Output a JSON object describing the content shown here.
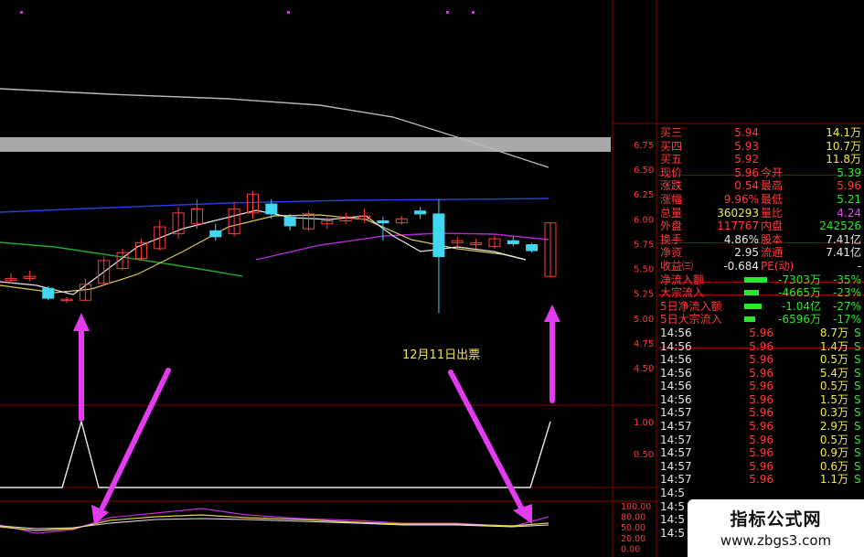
{
  "chart_data": {
    "type": "candlestick",
    "price_axis": {
      "ticks": [
        "6.75",
        "6.50",
        "6.25",
        "6.00",
        "5.75",
        "5.50",
        "5.25",
        "5.00",
        "4.75",
        "4.50"
      ],
      "range": [
        4.5,
        6.75
      ]
    },
    "candles": [
      {
        "o": 5.38,
        "c": 5.4,
        "h": 5.45,
        "l": 5.35
      },
      {
        "o": 5.4,
        "c": 5.42,
        "h": 5.48,
        "l": 5.37
      },
      {
        "o": 5.3,
        "c": 5.2,
        "h": 5.32,
        "l": 5.18
      },
      {
        "o": 5.18,
        "c": 5.19,
        "h": 5.21,
        "l": 5.15
      },
      {
        "o": 5.18,
        "c": 5.34,
        "h": 5.4,
        "l": 5.18
      },
      {
        "o": 5.35,
        "c": 5.58,
        "h": 5.62,
        "l": 5.33
      },
      {
        "o": 5.5,
        "c": 5.66,
        "h": 5.7,
        "l": 5.48
      },
      {
        "o": 5.6,
        "c": 5.76,
        "h": 5.8,
        "l": 5.58
      },
      {
        "o": 5.7,
        "c": 5.92,
        "h": 5.98,
        "l": 5.68
      },
      {
        "o": 5.85,
        "c": 6.06,
        "h": 6.12,
        "l": 5.8
      },
      {
        "o": 5.95,
        "c": 6.1,
        "h": 6.2,
        "l": 5.9
      },
      {
        "o": 5.88,
        "c": 5.82,
        "h": 5.95,
        "l": 5.78
      },
      {
        "o": 5.85,
        "c": 6.1,
        "h": 6.17,
        "l": 5.82
      },
      {
        "o": 6.06,
        "c": 6.25,
        "h": 6.28,
        "l": 6.0
      },
      {
        "o": 6.15,
        "c": 6.05,
        "h": 6.2,
        "l": 6.0
      },
      {
        "o": 6.02,
        "c": 5.93,
        "h": 6.05,
        "l": 5.88
      },
      {
        "o": 5.9,
        "c": 6.05,
        "h": 6.08,
        "l": 5.88
      },
      {
        "o": 5.95,
        "c": 5.98,
        "h": 6.02,
        "l": 5.9
      },
      {
        "o": 5.98,
        "c": 6.02,
        "h": 6.06,
        "l": 5.95
      },
      {
        "o": 6.0,
        "c": 6.03,
        "h": 6.1,
        "l": 5.96
      },
      {
        "o": 5.98,
        "c": 5.96,
        "h": 6.02,
        "l": 5.78
      },
      {
        "o": 5.96,
        "c": 6.0,
        "h": 6.03,
        "l": 5.94
      },
      {
        "o": 6.08,
        "c": 6.05,
        "h": 6.12,
        "l": 6.0
      },
      {
        "o": 6.05,
        "c": 5.62,
        "h": 6.2,
        "l": 5.05
      },
      {
        "o": 5.76,
        "c": 5.78,
        "h": 5.82,
        "l": 5.72
      },
      {
        "o": 5.74,
        "c": 5.76,
        "h": 5.8,
        "l": 5.7
      },
      {
        "o": 5.72,
        "c": 5.8,
        "h": 5.83,
        "l": 5.7
      },
      {
        "o": 5.78,
        "c": 5.75,
        "h": 5.82,
        "l": 5.72
      },
      {
        "o": 5.74,
        "c": 5.68,
        "h": 5.76,
        "l": 5.66
      },
      {
        "o": 5.42,
        "c": 5.96,
        "h": 5.96,
        "l": 5.42
      }
    ],
    "indicator_axis": {
      "ticks": [
        "1.00",
        "0.50"
      ],
      "range": [
        0,
        1.2
      ]
    },
    "oscillator_axis": {
      "ticks": [
        "100.00",
        "80.00",
        "50.00",
        "20.00",
        "0.00"
      ],
      "range": [
        0,
        100
      ]
    },
    "annotation": "12月11日出票"
  },
  "quotes_top": [
    {
      "label": "买三",
      "price": "5.94",
      "vol": "14.1万"
    },
    {
      "label": "买四",
      "price": "5.93",
      "vol": "10.7万"
    },
    {
      "label": "买五",
      "price": "5.92",
      "vol": "11.8万"
    }
  ],
  "stats": [
    {
      "l1": "现价",
      "v1": "5.96",
      "c1": "#ff3b3b",
      "l2": "今开",
      "v2": "5.39",
      "c2": "#2fe62f"
    },
    {
      "l1": "涨跌",
      "v1": "0.54",
      "c1": "#ff3b3b",
      "l2": "最高",
      "v2": "5.96",
      "c2": "#ff3b3b"
    },
    {
      "l1": "涨幅",
      "v1": "9.96%",
      "c1": "#ff3b3b",
      "l2": "最低",
      "v2": "5.21",
      "c2": "#2fe62f"
    },
    {
      "l1": "总量",
      "v1": "360293",
      "c1": "#f2e94a",
      "l2": "量比",
      "v2": "4.24",
      "c2": "#d94cf2"
    },
    {
      "l1": "外盘",
      "v1": "117767",
      "c1": "#ff3b3b",
      "l2": "内盘",
      "v2": "242526",
      "c2": "#2fe62f"
    }
  ],
  "stats2": [
    {
      "l1": "换手",
      "v1": "4.86%",
      "l2": "股本",
      "v2": "7.41亿"
    },
    {
      "l1": "净资",
      "v1": "2.95",
      "l2": "流通",
      "v2": "7.41亿"
    },
    {
      "l1": "收益㈢",
      "v1": "-0.684",
      "l2": "PE(动)",
      "v2": "-"
    }
  ],
  "flows": [
    {
      "label": "净流入额",
      "val": "-7303万",
      "pct": "-35%",
      "bar": 0.35
    },
    {
      "label": "大宗流入",
      "val": "-4665万",
      "pct": "-23%",
      "bar": 0.23
    },
    {
      "label": "5日净流入额",
      "val": "-1.04亿",
      "pct": "-27%",
      "bar": 0.27
    },
    {
      "label": "5日大宗流入",
      "val": "-6596万",
      "pct": "-17%",
      "bar": 0.17
    }
  ],
  "ticks": [
    {
      "time": "14:56",
      "price": "5.96",
      "vol": "8.7万",
      "side": "S"
    },
    {
      "time": "14:56",
      "price": "5.96",
      "vol": "1.4万",
      "side": "S"
    },
    {
      "time": "14:56",
      "price": "5.96",
      "vol": "0.5万",
      "side": "S"
    },
    {
      "time": "14:56",
      "price": "5.96",
      "vol": "5.4万",
      "side": "S"
    },
    {
      "time": "14:56",
      "price": "5.96",
      "vol": "0.5万",
      "side": "S"
    },
    {
      "time": "14:56",
      "price": "5.96",
      "vol": "1.5万",
      "side": "S"
    },
    {
      "time": "14:57",
      "price": "5.96",
      "vol": "0.3万",
      "side": "S"
    },
    {
      "time": "14:57",
      "price": "5.96",
      "vol": "2.9万",
      "side": "S"
    },
    {
      "time": "14:57",
      "price": "5.96",
      "vol": "0.5万",
      "side": "S"
    },
    {
      "time": "14:57",
      "price": "5.96",
      "vol": "0.9万",
      "side": "S"
    },
    {
      "time": "14:57",
      "price": "5.96",
      "vol": "0.6万",
      "side": "S"
    },
    {
      "time": "14:57",
      "price": "5.96",
      "vol": "1.1万",
      "side": "S"
    },
    {
      "time": "14:5",
      "price": "",
      "vol": "",
      "side": ""
    },
    {
      "time": "14:5",
      "price": "",
      "vol": "",
      "side": ""
    },
    {
      "time": "14:5",
      "price": "",
      "vol": "",
      "side": ""
    },
    {
      "time": "14:5",
      "price": "",
      "vol": "",
      "side": ""
    }
  ],
  "watermark": {
    "line1": "指标公式网",
    "line2": "www.zbgs3.com"
  },
  "colors": {
    "up": "#ff3b3b",
    "down": "#41d6f2",
    "grid": "#8a0000",
    "arrow": "#e23bf0"
  }
}
